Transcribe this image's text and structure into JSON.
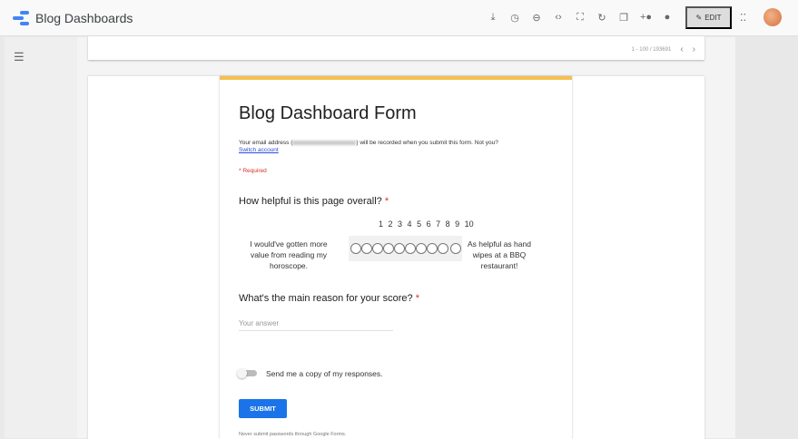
{
  "header": {
    "title": "Blog Dashboards",
    "edit_label": "EDIT",
    "icons": [
      "download-icon",
      "history-icon",
      "link-icon",
      "embed-icon",
      "fullscreen-icon",
      "refresh-icon",
      "copy-icon",
      "share-icon",
      "help-icon"
    ]
  },
  "pager": {
    "range": "1 - 100 / 193691",
    "prev": "‹",
    "next": "›"
  },
  "form": {
    "title": "Blog Dashboard Form",
    "email_prefix": "Your email address (",
    "email_suffix": ") will be recorded when you submit this form. Not you?",
    "switch_account": "Switch account",
    "required_note": "* Required",
    "q1": "How helpful is this page overall?",
    "q1_star": "*",
    "scale": [
      "1",
      "2",
      "3",
      "4",
      "5",
      "6",
      "7",
      "8",
      "9",
      "10"
    ],
    "low_label": "I would've gotten more value from reading my horoscope.",
    "high_label": "As helpful as hand wipes at a BBQ restaurant!",
    "q2": "What's the main reason for your score?",
    "q2_star": "*",
    "answer_placeholder": "Your answer",
    "copy_label": "Send me a copy of my responses.",
    "submit": "SUBMIT",
    "never": "Never submit passwords through Google Forms."
  },
  "colors": {
    "accent": "#1a73e8",
    "form_top": "#f6bf4f",
    "required": "#d93025"
  }
}
